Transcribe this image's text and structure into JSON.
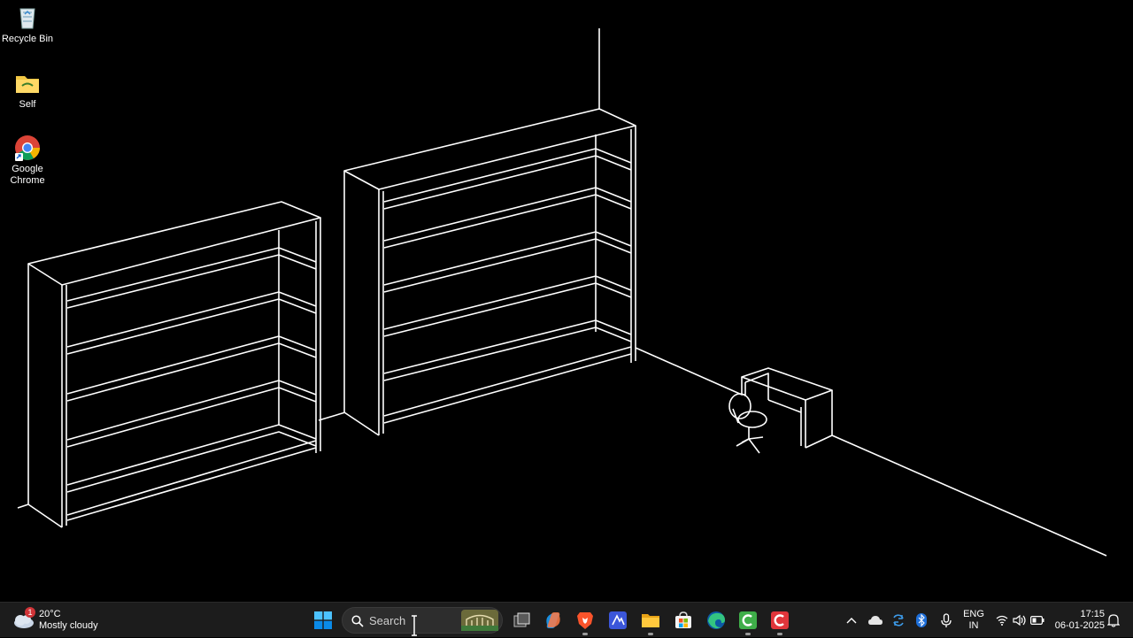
{
  "desktop": {
    "icons": [
      {
        "label": "Recycle Bin",
        "icon": "recycle-bin-icon"
      },
      {
        "label": "Self",
        "icon": "folder-icon"
      },
      {
        "label": "Google Chrome",
        "icon": "chrome-icon"
      }
    ]
  },
  "taskbar": {
    "weather": {
      "temp": "20°C",
      "condition": "Mostly cloudy",
      "badge": "1"
    },
    "search": {
      "placeholder": "Search"
    },
    "apps": [
      {
        "name": "start",
        "icon": "windows-start-icon"
      },
      {
        "name": "search-highlight",
        "icon": "search-highlight-icon"
      },
      {
        "name": "task-view",
        "icon": "task-view-icon"
      },
      {
        "name": "copilot",
        "icon": "copilot-icon"
      },
      {
        "name": "brave",
        "icon": "brave-browser-icon"
      },
      {
        "name": "app",
        "icon": "app-icon"
      },
      {
        "name": "file-explorer",
        "icon": "file-explorer-icon"
      },
      {
        "name": "microsoft-store",
        "icon": "store-icon"
      },
      {
        "name": "edge",
        "icon": "edge-icon"
      },
      {
        "name": "camtasia",
        "icon": "camtasia-icon"
      },
      {
        "name": "camtasia-recorder",
        "icon": "recorder-icon"
      }
    ],
    "tray": {
      "language_line1": "ENG",
      "language_line2": "IN",
      "time": "17:15",
      "date": "06-01-2025"
    }
  },
  "colors": {
    "taskbar_bg": "#1c1c1c",
    "wallpaper_bg": "#000000",
    "accent": "#0078d4"
  }
}
